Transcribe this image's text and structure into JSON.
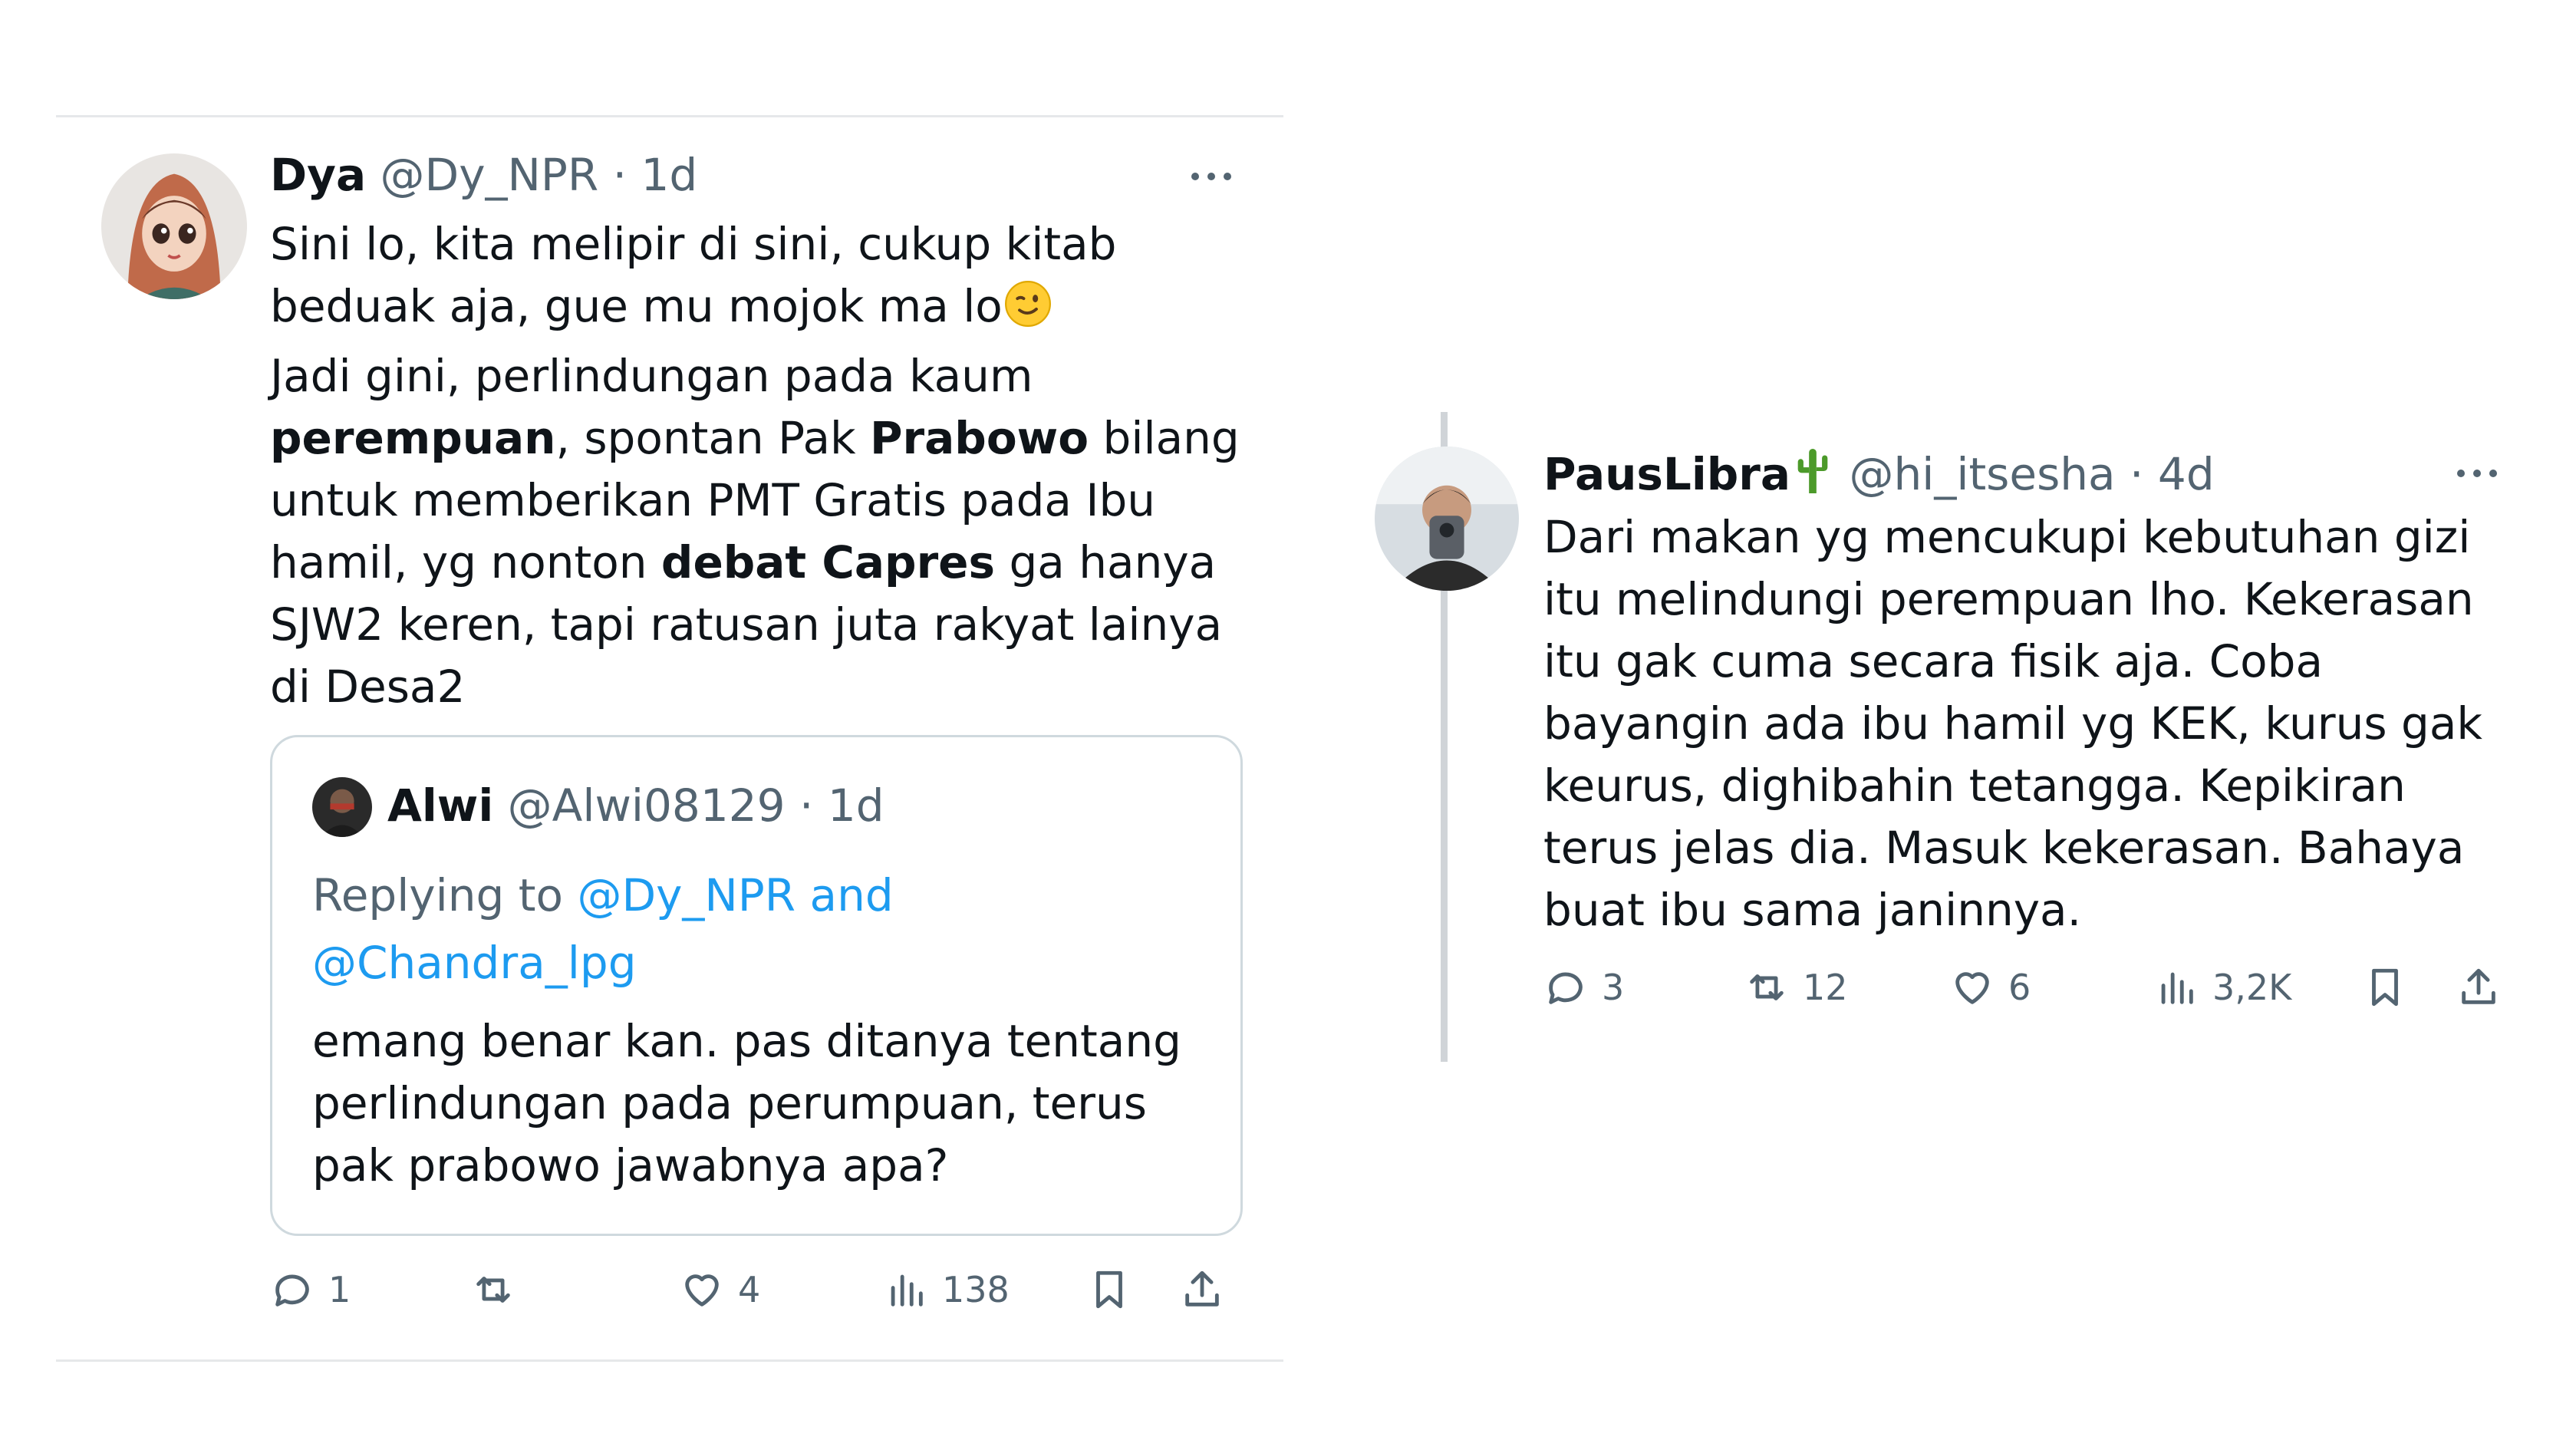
{
  "left_tweet": {
    "author": {
      "name": "Dya",
      "handle": "@Dy_NPR",
      "time": "· 1d"
    },
    "icons": {
      "more": "more-dots-icon"
    },
    "lines": [
      [
        {
          "t": "Sini lo, kita melipir di sini, cukup kitab"
        }
      ],
      [
        {
          "t": "beduak aja, gue mu mojok ma lo"
        }
      ],
      [
        {
          "t": "Jadi gini, perlindungan pada kaum"
        }
      ],
      [
        {
          "t": "perempuan",
          "b": true
        },
        {
          "t": ", spontan Pak "
        },
        {
          "t": "Prabowo",
          "b": true
        },
        {
          "t": " bilang"
        }
      ],
      [
        {
          "t": "untuk memberikan PMT Gratis pada Ibu"
        }
      ],
      [
        {
          "t": "hamil, yg nonton "
        },
        {
          "t": "debat Capres",
          "b": true
        },
        {
          "t": " ga hanya"
        }
      ],
      [
        {
          "t": "SJW2 keren, tapi ratusan juta rakyat lainya"
        }
      ],
      [
        {
          "t": "di Desa2"
        }
      ]
    ],
    "emoji": "winking-face",
    "quote": {
      "name": "Alwi",
      "handle": "@Alwi08129",
      "time": "· 1d",
      "replying_prefix": "Replying to",
      "replying_line1": "@Dy_NPR and",
      "replying_line2": "@Chandra_lpg",
      "lines": [
        "emang benar kan. pas ditanya tentang",
        "perlindungan pada perumpuan, terus",
        "pak prabowo jawabnya apa?"
      ]
    },
    "actions": {
      "replies": "1",
      "retweets": "",
      "likes": "4",
      "views": "138"
    }
  },
  "right_tweet": {
    "author": {
      "name": "PausLibra",
      "name_emoji": "cactus",
      "handle": "@hi_itsesha",
      "time": "· 4d"
    },
    "lines": [
      "Dari makan yg mencukupi kebutuhan gizi",
      "itu melindungi perempuan lho. Kekerasan",
      "itu gak cuma secara fisik aja. Coba",
      "bayangin ada ibu hamil yg KEK, kurus gak",
      "keurus, dighibahin tetangga. Kepikiran",
      "terus jelas dia. Masuk kekerasan. Bahaya",
      "buat ibu sama janinnya."
    ],
    "actions": {
      "replies": "3",
      "retweets": "12",
      "likes": "6",
      "views": "3,2K"
    }
  },
  "colors": {
    "text": "#0f1419",
    "muted": "#536471",
    "link": "#1d9bf0",
    "border": "#cfd9de"
  }
}
